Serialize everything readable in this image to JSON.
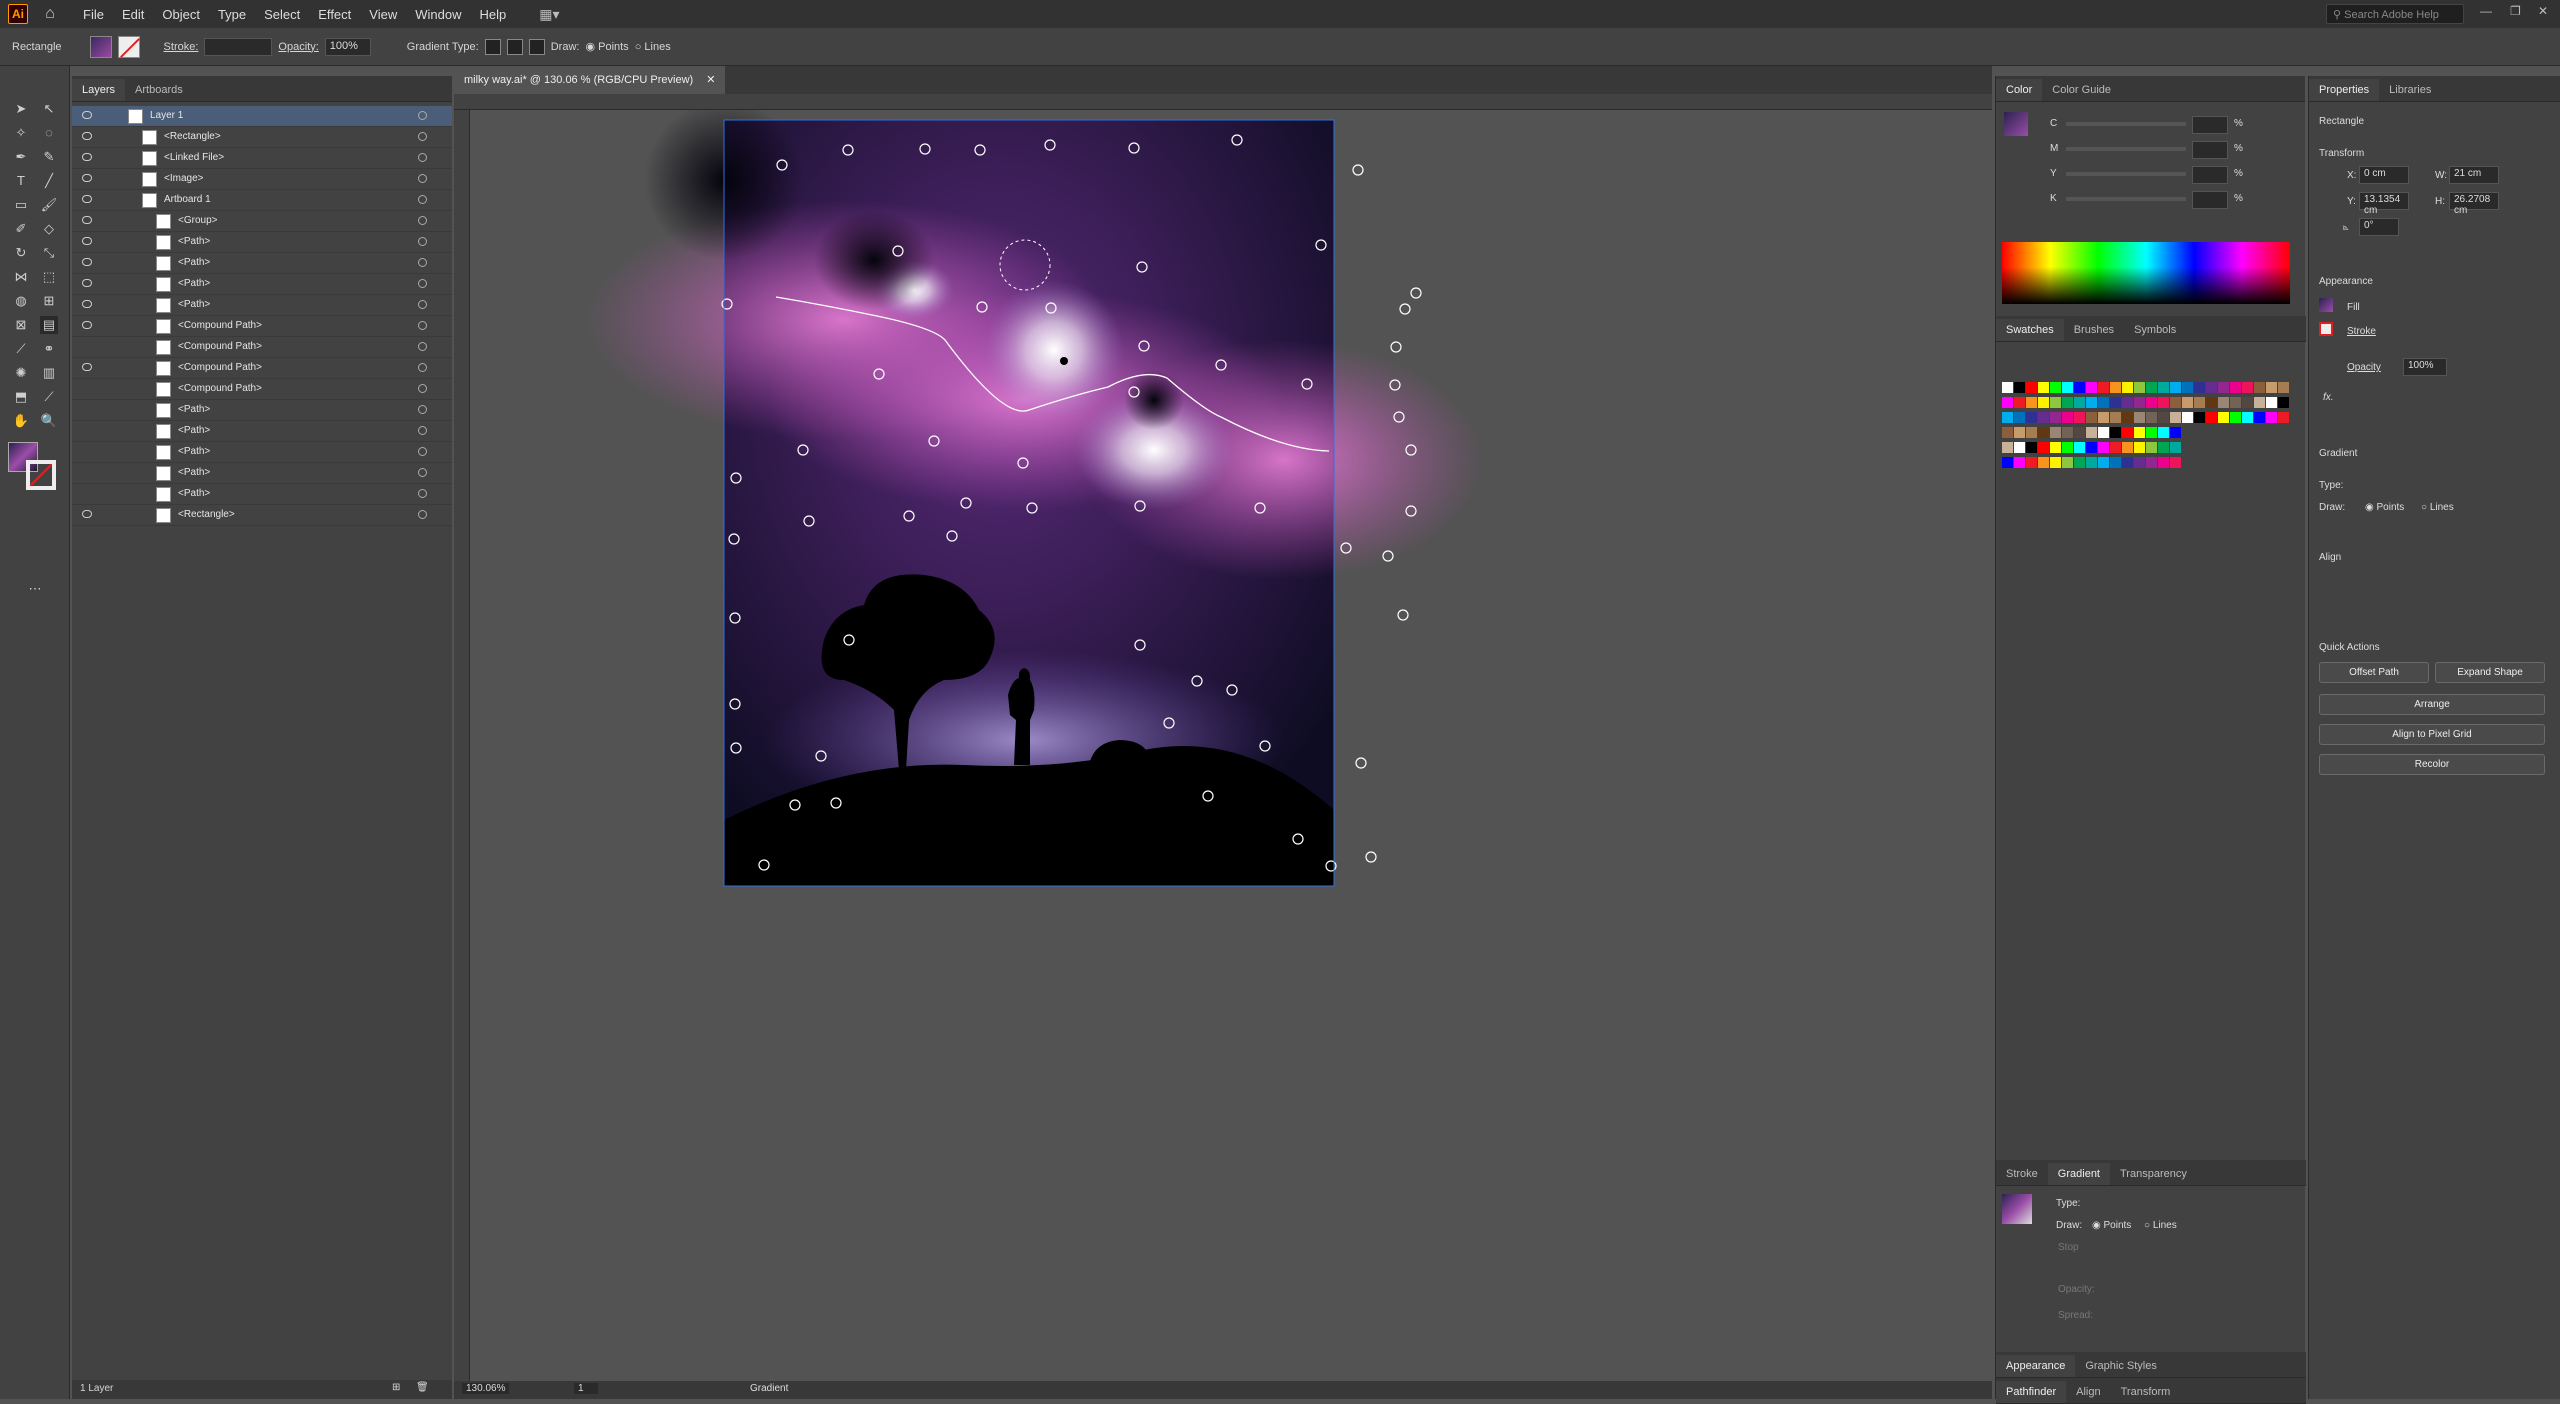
{
  "app": {
    "logo": "Ai",
    "search_placeholder": "Search Adobe Help"
  },
  "menu": [
    "File",
    "Edit",
    "Object",
    "Type",
    "Select",
    "Effect",
    "View",
    "Window",
    "Help"
  ],
  "options_bar": {
    "object_type": "Rectangle",
    "stroke_label": "Stroke:",
    "opacity_label": "Opacity:",
    "opacity_value": "100%",
    "gradient_type_label": "Gradient Type:",
    "draw_label": "Draw:",
    "points_label": "Points",
    "lines_label": "Lines"
  },
  "layers_panel": {
    "tabs": [
      "Layers",
      "Artboards"
    ],
    "rows": [
      {
        "name": "Layer 1",
        "indent": 0,
        "selected": true,
        "eye": true
      },
      {
        "name": "<Rectangle>",
        "indent": 1,
        "eye": true
      },
      {
        "name": "<Linked File>",
        "indent": 1,
        "eye": true
      },
      {
        "name": "<Image>",
        "indent": 1,
        "eye": true
      },
      {
        "name": "Artboard 1",
        "indent": 1,
        "eye": true
      },
      {
        "name": "<Group>",
        "indent": 2,
        "eye": true
      },
      {
        "name": "<Path>",
        "indent": 2,
        "eye": true
      },
      {
        "name": "<Path>",
        "indent": 2,
        "eye": true
      },
      {
        "name": "<Path>",
        "indent": 2,
        "eye": true
      },
      {
        "name": "<Path>",
        "indent": 2,
        "eye": true
      },
      {
        "name": "<Compound Path>",
        "indent": 2,
        "eye": true
      },
      {
        "name": "<Compound Path>",
        "indent": 2,
        "eye": false
      },
      {
        "name": "<Compound Path>",
        "indent": 2,
        "eye": true
      },
      {
        "name": "<Compound Path>",
        "indent": 2,
        "eye": false
      },
      {
        "name": "<Path>",
        "indent": 2,
        "eye": false
      },
      {
        "name": "<Path>",
        "indent": 2,
        "eye": false
      },
      {
        "name": "<Path>",
        "indent": 2,
        "eye": false
      },
      {
        "name": "<Path>",
        "indent": 2,
        "eye": false
      },
      {
        "name": "<Path>",
        "indent": 2,
        "eye": false
      },
      {
        "name": "<Rectangle>",
        "indent": 2,
        "eye": true
      }
    ],
    "footer": "1 Layer"
  },
  "document": {
    "tab_title": "milky way.ai* @ 130.06 % (RGB/CPU Preview)",
    "zoom": "130.06%",
    "artboard": "1",
    "tool_status": "Gradient"
  },
  "color_panel": {
    "tabs": [
      "Color",
      "Color Guide"
    ],
    "channels": [
      "C",
      "M",
      "Y",
      "K"
    ],
    "unit": "%"
  },
  "swatches_panel": {
    "tabs": [
      "Swatches",
      "Brushes",
      "Symbols"
    ]
  },
  "gradient_panel": {
    "tabs": [
      "Stroke",
      "Gradient",
      "Transparency"
    ],
    "type_label": "Type:",
    "draw_label": "Draw:",
    "points_label": "Points",
    "lines_label": "Lines",
    "stop_label": "Stop",
    "opacity_label": "Opacity:",
    "spread_label": "Spread:"
  },
  "bottom_tabs": [
    [
      "Appearance",
      "Graphic Styles"
    ],
    [
      "Pathfinder",
      "Align",
      "Transform"
    ]
  ],
  "properties": {
    "tabs": [
      "Properties",
      "Libraries"
    ],
    "object": "Rectangle",
    "transform_title": "Transform",
    "x_label": "X:",
    "x_value": "0 cm",
    "y_label": "Y:",
    "y_value": "13.1354 cm",
    "w_label": "W:",
    "w_value": "21 cm",
    "h_label": "H:",
    "h_value": "26.2708 cm",
    "angle_value": "0°",
    "appearance_title": "Appearance",
    "fill_label": "Fill",
    "stroke_label": "Stroke",
    "opacity_label": "Opacity",
    "opacity_value": "100%",
    "fx_label": "fx.",
    "gradient_title": "Gradient",
    "type_label": "Type:",
    "draw_label": "Draw:",
    "points_label": "Points",
    "lines_label": "Lines",
    "align_title": "Align",
    "quick_actions_title": "Quick Actions",
    "offset_path": "Offset Path",
    "expand_shape": "Expand Shape",
    "arrange": "Arrange",
    "align_pixel": "Align to Pixel Grid",
    "recolor": "Recolor"
  },
  "colors": {
    "accent": "#2f6fe3",
    "selection": "#4b5e79",
    "ui_dark": "#323232",
    "ui_mid": "#424242"
  }
}
